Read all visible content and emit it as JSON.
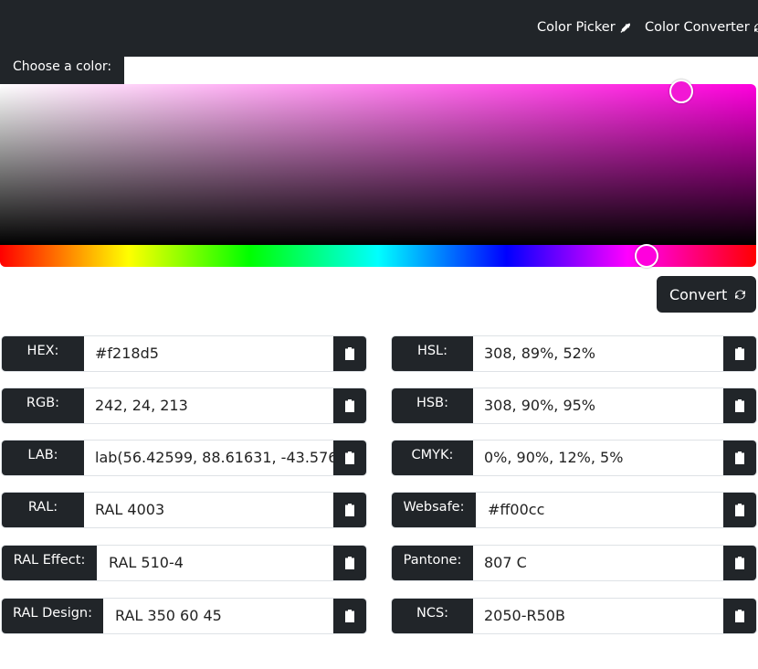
{
  "nav": {
    "picker_label": "Color Picker",
    "converter_label": "Color Converter",
    "picker_icon": "eyedropper-icon",
    "converter_icon": "refresh-icon"
  },
  "picker": {
    "choose_label": "Choose a color:",
    "selected_color": "#f218d5",
    "hue_color": "#ff00dd",
    "saturation": 0.9,
    "brightness": 0.95,
    "hue_degrees": 308
  },
  "convert": {
    "label": "Convert",
    "icon": "refresh-icon"
  },
  "left_fields": [
    {
      "label": "HEX:",
      "value": "#f218d5"
    },
    {
      "label": "RGB:",
      "value": "242, 24, 213"
    },
    {
      "label": "LAB:",
      "value": "lab(56.42599, 88.61631, -43.576"
    },
    {
      "label": "RAL:",
      "value": "RAL 4003"
    },
    {
      "label": "RAL Effect:",
      "value": "RAL 510-4"
    },
    {
      "label": "RAL Design:",
      "value": "RAL 350 60 45"
    }
  ],
  "right_fields": [
    {
      "label": "HSL:",
      "value": "308, 89%, 52%"
    },
    {
      "label": "HSB:",
      "value": "308, 90%, 95%"
    },
    {
      "label": "CMYK:",
      "value": "0%, 90%, 12%, 5%"
    },
    {
      "label": "Websafe:",
      "value": "#ff00cc"
    },
    {
      "label": "Pantone:",
      "value": "807 C"
    },
    {
      "label": "NCS:",
      "value": "2050-R50B"
    }
  ],
  "colors": {
    "dark": "#212529",
    "accent": "#f218d5"
  }
}
